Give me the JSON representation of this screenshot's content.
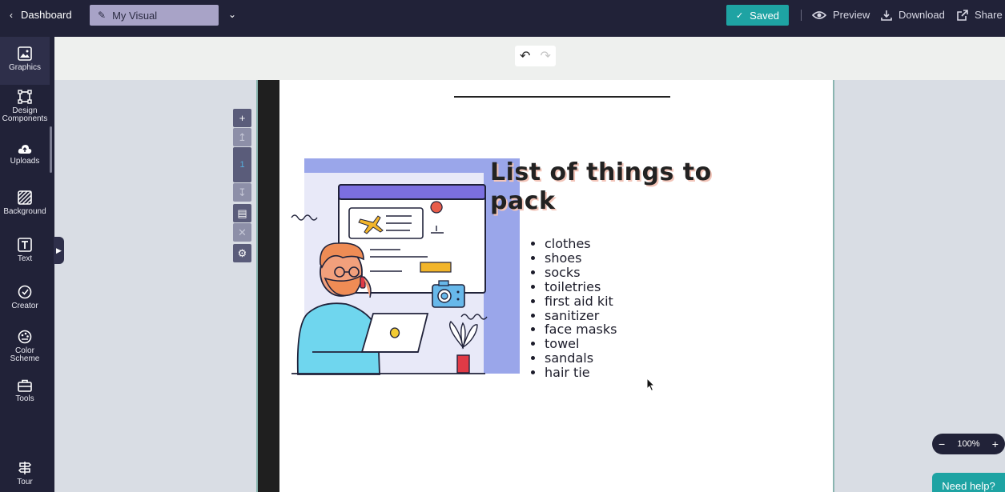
{
  "header": {
    "back_label": "Dashboard",
    "title": "My Visual",
    "saved_label": "Saved",
    "preview_label": "Preview",
    "download_label": "Download",
    "share_label": "Share"
  },
  "sidebar": {
    "items": [
      {
        "label": "Graphics",
        "icon": "image-icon"
      },
      {
        "label": "Design Components",
        "icon": "components-icon"
      },
      {
        "label": "Uploads",
        "icon": "upload-cloud-icon"
      },
      {
        "label": "Background",
        "icon": "background-icon"
      },
      {
        "label": "Text",
        "icon": "text-icon"
      },
      {
        "label": "Creator",
        "icon": "creator-icon"
      },
      {
        "label": "Color Scheme",
        "icon": "palette-icon"
      },
      {
        "label": "Tools",
        "icon": "toolbox-icon"
      },
      {
        "label": "Tour",
        "icon": "signpost-icon"
      }
    ]
  },
  "page_controls": {
    "page_number": "1"
  },
  "canvas": {
    "heading": "List of things to pack",
    "items": [
      "clothes",
      "shoes",
      "socks",
      "toiletries",
      "first aid kit",
      "sanitizer",
      "face masks",
      "towel",
      "sandals",
      "hair tie"
    ]
  },
  "zoom": {
    "value": "100%",
    "minus": "−",
    "plus": "+"
  },
  "help": {
    "label": "Need help?"
  },
  "colors": {
    "topbar": "#212238",
    "accent": "#1ea3a3",
    "illustration_blue": "#9aa6ea"
  }
}
